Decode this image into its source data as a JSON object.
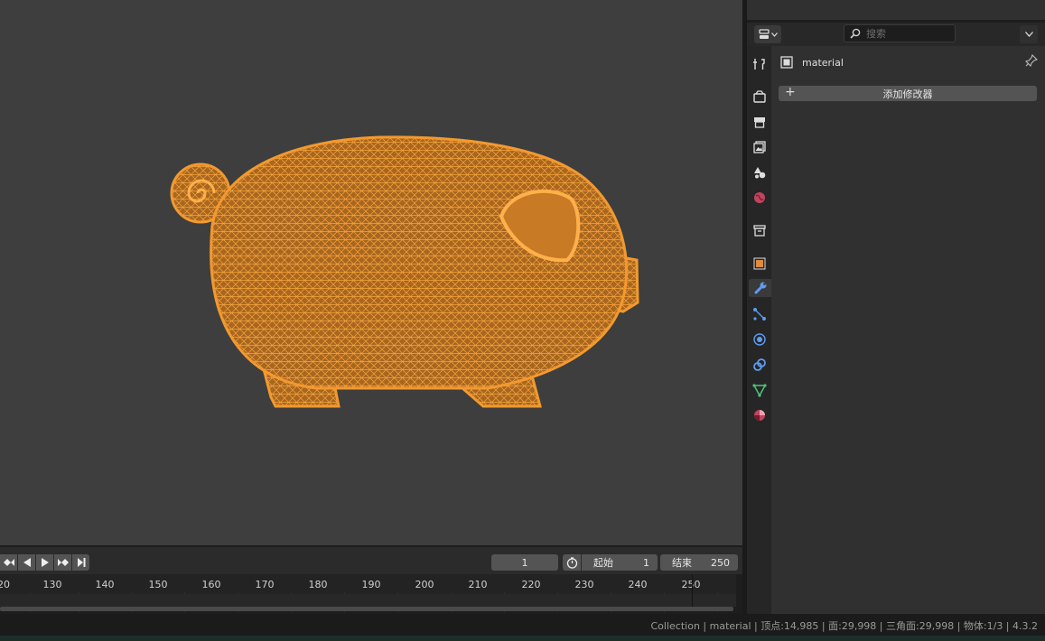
{
  "props_header": {
    "search_placeholder": "搜索",
    "editor_type_icon": "properties-editor-icon",
    "options_icon": "chevron-down-icon"
  },
  "properties": {
    "object_name": "material",
    "add_modifier_label": "添加修改器",
    "active_tab": "modifiers",
    "tabs": [
      "tool",
      "render",
      "output",
      "view-layer",
      "scene",
      "world",
      "collection",
      "object",
      "modifiers",
      "particles",
      "physics",
      "constraints",
      "data",
      "material"
    ]
  },
  "timeline": {
    "current_frame": "1",
    "start_label": "起始",
    "start_value": "1",
    "end_label": "结束",
    "end_value": "250",
    "ruler": [
      "20",
      "130",
      "140",
      "150",
      "160",
      "170",
      "180",
      "190",
      "200",
      "210",
      "220",
      "230",
      "240",
      "250"
    ]
  },
  "status_bar": {
    "text": "Collection | material | 顶点:14,985 | 面:29,998 | 三角面:29,998 | 物体:1/3 | 4.3.2"
  },
  "colors": {
    "wireframe": "#f2962c",
    "viewport_bg": "#3e3e3e"
  }
}
